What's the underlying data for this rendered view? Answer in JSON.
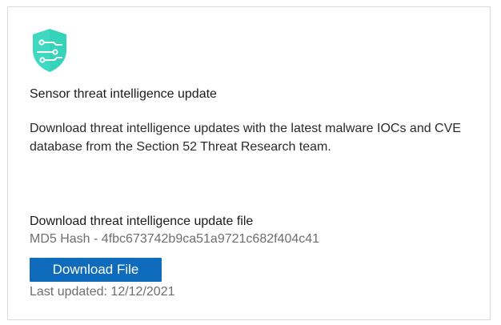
{
  "colors": {
    "accent": "#0f6cbd",
    "icon_teal": "#3fd9c2",
    "icon_teal_light": "#7fe8d8",
    "muted_text": "#6e6e6e"
  },
  "card": {
    "icon": "shield-circuit-icon",
    "title": "Sensor threat intelligence update",
    "description": "Download threat intelligence updates with the latest malware IOCs and CVE database from the Section 52 Threat Research team."
  },
  "download_section": {
    "title": "Download threat intelligence update file",
    "hash_text": "MD5 Hash - 4fbc673742b9ca51a9721c682f404c41",
    "button_label": "Download File",
    "last_updated": "Last updated: 12/12/2021"
  }
}
